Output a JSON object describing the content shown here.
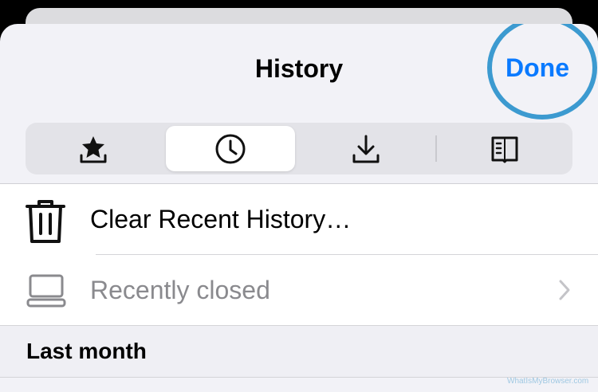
{
  "header": {
    "title": "History",
    "done_label": "Done"
  },
  "segments": [
    {
      "icon": "bookmarks-icon",
      "selected": false
    },
    {
      "icon": "clock-icon",
      "selected": true
    },
    {
      "icon": "download-icon",
      "selected": false
    },
    {
      "icon": "reading-list-icon",
      "selected": false
    }
  ],
  "rows": [
    {
      "label": "Clear Recent History…",
      "icon": "trash-icon"
    },
    {
      "label": "Recently closed",
      "icon": "laptop-icon"
    }
  ],
  "section": {
    "label": "Last month"
  },
  "watermark": "WhatIsMyBrowser.com",
  "colors": {
    "accent": "#0a7aff",
    "highlight_ring": "#3c9ad0"
  }
}
